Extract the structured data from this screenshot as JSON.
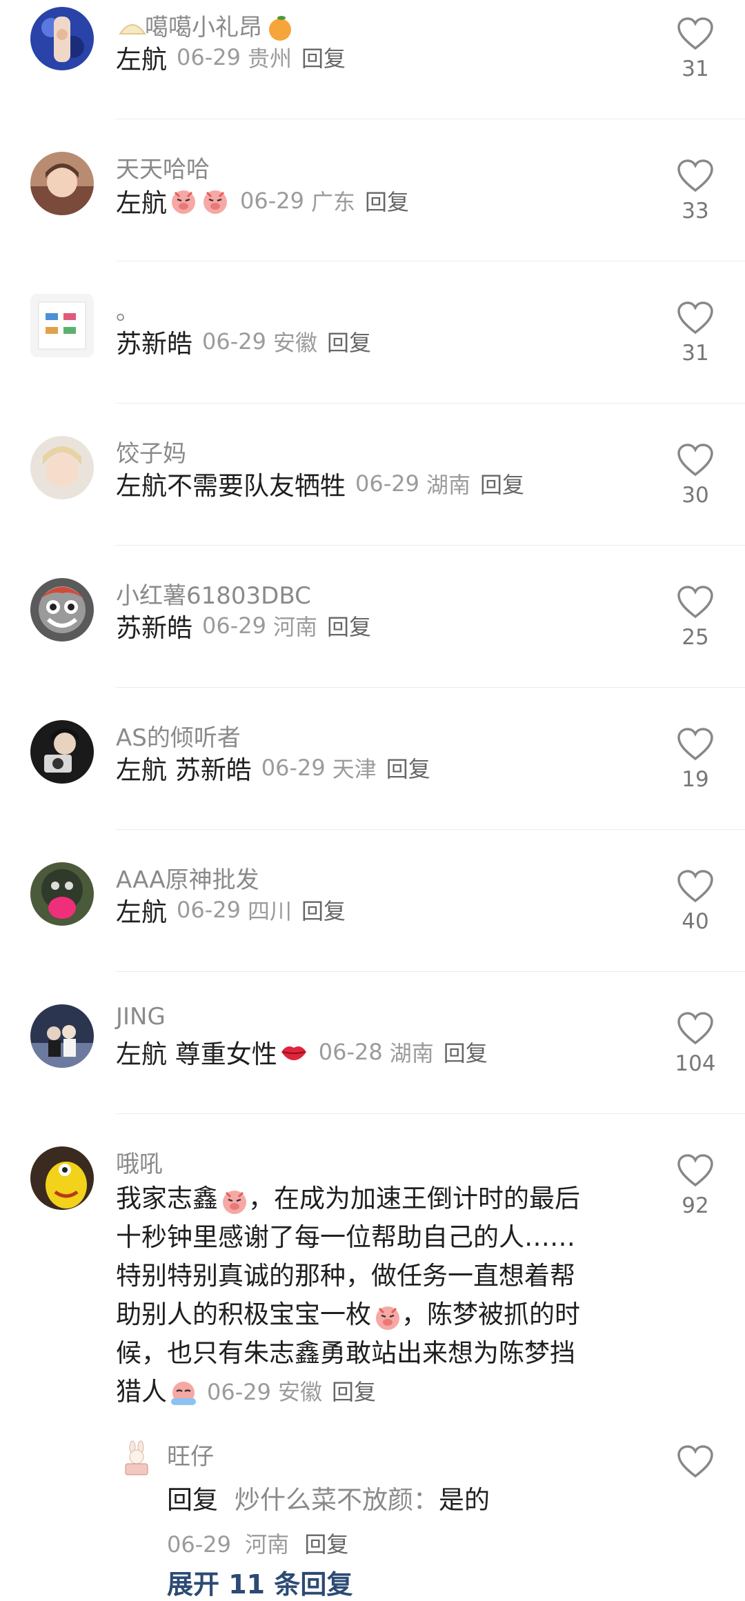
{
  "comments": [
    {
      "username": "噶噶小礼昂",
      "text": "左航",
      "date": "06-29",
      "location": "贵州",
      "reply": "回复",
      "likes": "31"
    },
    {
      "username": "天天哈哈",
      "text": "左航",
      "date": "06-29",
      "location": "广东",
      "reply": "回复",
      "likes": "33"
    },
    {
      "username": "。",
      "text": "苏新皓",
      "date": "06-29",
      "location": "安徽",
      "reply": "回复",
      "likes": "31"
    },
    {
      "username": "饺子妈",
      "text": "左航不需要队友牺牲",
      "date": "06-29",
      "location": "湖南",
      "reply": "回复",
      "likes": "30"
    },
    {
      "username": "小红薯61803DBC",
      "text": "苏新皓",
      "date": "06-29",
      "location": "河南",
      "reply": "回复",
      "likes": "25"
    },
    {
      "username": "AS的倾听者",
      "text": "左航 苏新皓",
      "date": "06-29",
      "location": "天津",
      "reply": "回复",
      "likes": "19"
    },
    {
      "username": "AAA原神批发",
      "text": "左航",
      "date": "06-29",
      "location": "四川",
      "reply": "回复",
      "likes": "40"
    },
    {
      "username": "JING",
      "text": "左航 尊重女性",
      "date": "06-28",
      "location": "湖南",
      "reply": "回复",
      "likes": "104"
    },
    {
      "username": "哦吼",
      "likes": "92",
      "date": "06-29",
      "location": "安徽",
      "reply": "回复",
      "lines": [
        "我家志鑫",
        "，在成为加速王倒计时的最后",
        "十秒钟里感谢了每一位帮助自己的人……",
        "特别特别真诚的那种，做任务一直想着帮",
        "助别人的积极宝宝一枚",
        "，陈梦被抓的时",
        "候，也只有朱志鑫勇敢站出来想为陈梦挡",
        "猎人"
      ]
    }
  ],
  "sub_reply": {
    "username": "旺仔",
    "prefix": "回复",
    "quoted": "炒什么菜不放颜：",
    "text": "是的",
    "date": "06-29",
    "location": "河南",
    "reply": "回复"
  },
  "expand_label": "展开 11 条回复",
  "colors": {
    "meta": "#9b9b9b",
    "expand": "#2c4a74",
    "heart": "#888888"
  }
}
